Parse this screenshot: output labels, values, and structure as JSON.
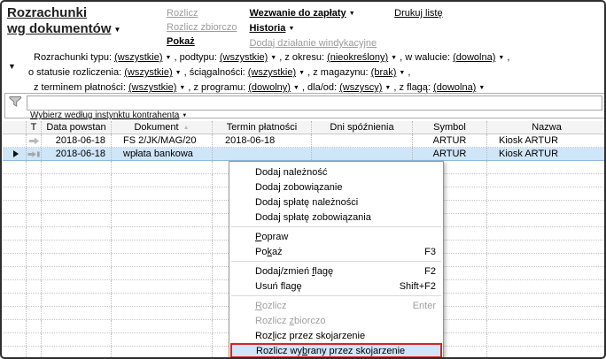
{
  "title": {
    "line1": "Rozrachunki",
    "line2": "wg dokumentów"
  },
  "toolbar": {
    "columns": [
      {
        "items": [
          {
            "label": "Rozlicz",
            "disabled": true
          },
          {
            "label": "Rozlicz zbiorczo",
            "disabled": true
          },
          {
            "label": "Pokaż",
            "bold": true
          }
        ]
      },
      {
        "items": [
          {
            "label": "Wezwanie do zapłaty",
            "bold": true,
            "dropdown": true
          },
          {
            "label": "Historia",
            "bold": true,
            "dropdown": true
          },
          {
            "label": "Dodaj działanie windykacyjne",
            "disabled": true
          }
        ]
      },
      {
        "items": [
          {
            "label": "Drukuj listę"
          }
        ]
      }
    ]
  },
  "filters": {
    "rows": [
      {
        "indent": true,
        "segments": [
          {
            "t": "Rozrachunki typu: "
          },
          {
            "l": "(wszystkie)"
          },
          {
            "t": " , podtypu: "
          },
          {
            "l": "(wszystkie)"
          },
          {
            "t": " , z okresu: "
          },
          {
            "l": "(nieokreślony)"
          },
          {
            "t": " , w walucie: "
          },
          {
            "l": "(dowolna)"
          },
          {
            "t": " ,"
          }
        ]
      },
      {
        "indent": false,
        "segments": [
          {
            "t": "o statusie rozliczenia: "
          },
          {
            "l": "(wszystkie)"
          },
          {
            "t": " , ściągalności: "
          },
          {
            "l": "(wszystkie)"
          },
          {
            "t": " , z magazynu: "
          },
          {
            "l": "(brak)"
          },
          {
            "t": " ,"
          }
        ]
      },
      {
        "indent": true,
        "segments": [
          {
            "t": "z terminem płatności: "
          },
          {
            "l": "(wszystkie)"
          },
          {
            "t": " , z programu: "
          },
          {
            "l": "(dowolny)"
          },
          {
            "t": " , dla/od: "
          },
          {
            "l": "(wszyscy)"
          },
          {
            "t": " , z flagą: "
          },
          {
            "l": "(dowolna)"
          }
        ]
      }
    ]
  },
  "search": {
    "value": "",
    "link_label": "Wybierz według instynktu kontrahenta"
  },
  "table": {
    "columns": [
      {
        "label": "",
        "width": 27,
        "align": "center",
        "name": "row-selector"
      },
      {
        "label": "T",
        "width": 17,
        "align": "center",
        "name": "type"
      },
      {
        "label": "Data powstan",
        "width": 79,
        "align": "right",
        "pad": 6,
        "name": "data-powstania"
      },
      {
        "label": "Dokument",
        "width": 114,
        "align": "left",
        "pad": 13,
        "sort": "asc",
        "name": "dokument"
      },
      {
        "label": "Termin płatności",
        "width": 112,
        "align": "left",
        "pad": 14,
        "name": "termin-platnosci"
      },
      {
        "label": "Dni spóźnienia",
        "width": 114,
        "align": "left",
        "pad": 8,
        "name": "dni-spoznienia"
      },
      {
        "label": "Symbol",
        "width": 84,
        "align": "center",
        "name": "symbol"
      },
      {
        "label": "Nazwa",
        "width": null,
        "align": "left",
        "pad": 13,
        "name": "nazwa"
      }
    ],
    "rows": [
      {
        "selected": false,
        "cells": [
          {
            "icon": ""
          },
          {
            "icon": "arrow-right"
          },
          {
            "text": "2018-06-18"
          },
          {
            "text": "FS 2/JK/MAG/20"
          },
          {
            "text": "2018-06-18"
          },
          {
            "text": ""
          },
          {
            "text": "ARTUR"
          },
          {
            "text": "Kiosk ARTUR"
          }
        ]
      },
      {
        "selected": true,
        "cells": [
          {
            "icon": "row-pointer"
          },
          {
            "icon": "arrow-right-box"
          },
          {
            "text": "2018-06-18"
          },
          {
            "text": "wpłata bankowa"
          },
          {
            "text": ""
          },
          {
            "text": ""
          },
          {
            "text": "ARTUR"
          },
          {
            "text": "Kiosk ARTUR"
          }
        ]
      }
    ],
    "empty_row_count": 15
  },
  "menu": {
    "items": [
      {
        "label": "Dodaj należność"
      },
      {
        "label": "Dodaj zobowiązanie"
      },
      {
        "label": "Dodaj spłatę należności"
      },
      {
        "label": "Dodaj spłatę zobowiązania",
        "sep_after": true
      },
      {
        "label": "Popraw",
        "accel": 0
      },
      {
        "label": "Pokaż",
        "accel": 2,
        "shortcut": "F3",
        "sep_after": true
      },
      {
        "label": "Dodaj/zmień flagę",
        "accel": 12,
        "shortcut": "F2"
      },
      {
        "label": "Usuń flagę",
        "accel": 8,
        "shortcut": "Shift+F2",
        "sep_after": true
      },
      {
        "label": "Rozlicz",
        "accel": 0,
        "shortcut": "Enter",
        "disabled": true
      },
      {
        "label": "Rozlicz zbiorczo",
        "accel": 8,
        "disabled": true
      },
      {
        "label": "Rozlicz przez skojarzenie",
        "accel": 3
      },
      {
        "label": "Rozlicz wybrany przez skojarzenie",
        "accel": 10,
        "highlighted": true
      }
    ]
  },
  "colors": {
    "selection_bg": "#cfe5f8",
    "highlight_border": "#dd2222",
    "link_disabled": "#9b9b9b",
    "grid_dotted": "#bbbbbb"
  }
}
